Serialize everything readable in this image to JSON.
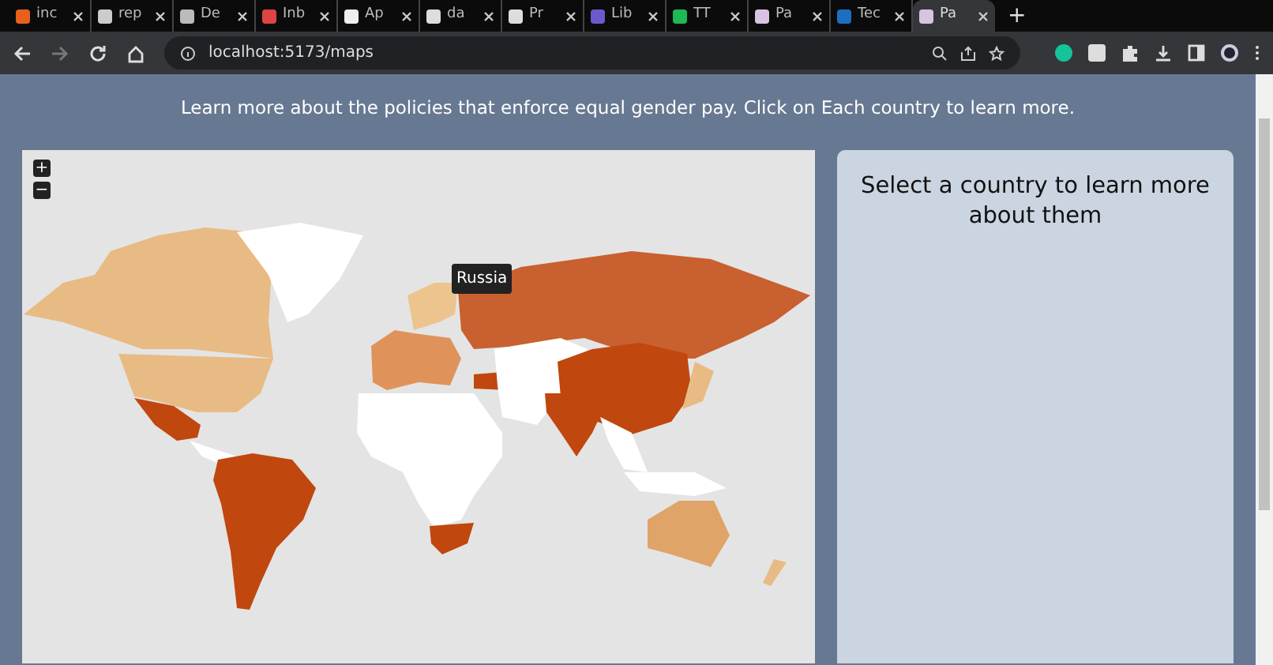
{
  "browser": {
    "tabs": [
      {
        "label": "inc",
        "selected": false
      },
      {
        "label": "rep",
        "selected": false
      },
      {
        "label": "De",
        "selected": false
      },
      {
        "label": "Inb",
        "selected": false
      },
      {
        "label": "Ap",
        "selected": false
      },
      {
        "label": "da",
        "selected": false
      },
      {
        "label": "Pr",
        "selected": false
      },
      {
        "label": "Lib",
        "selected": false
      },
      {
        "label": "TT",
        "selected": false
      },
      {
        "label": "Pa",
        "selected": false
      },
      {
        "label": "Tec",
        "selected": false
      },
      {
        "label": "Pa",
        "selected": true
      }
    ],
    "new_tab": "+",
    "address": "localhost:5173/maps"
  },
  "intro": "Learn more about the policies that enforce equal gender pay. Click on Each country to learn more.",
  "map": {
    "zoom_in": "+",
    "zoom_out": "−",
    "tooltip": "Russia"
  },
  "info_panel": {
    "heading": "Select a country to learn more about them"
  }
}
